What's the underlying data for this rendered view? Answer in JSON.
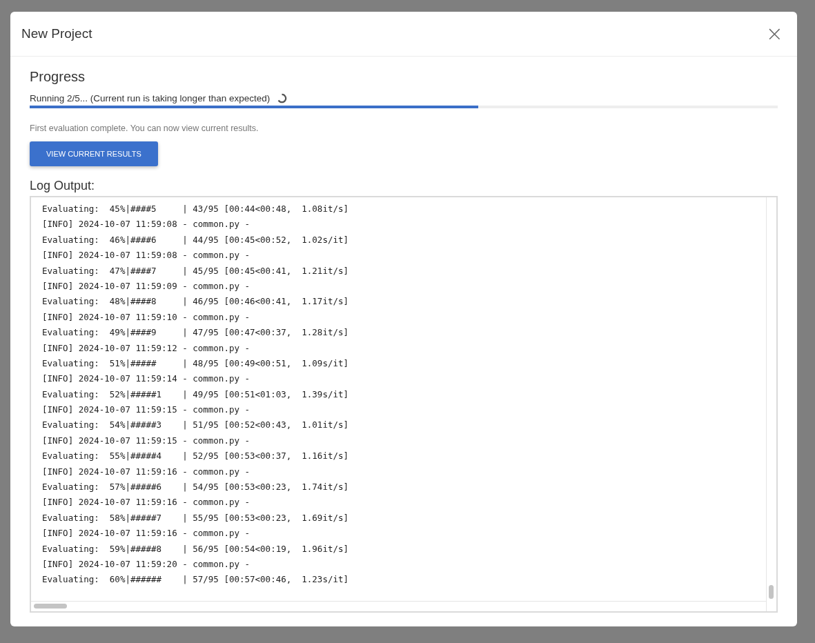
{
  "dialog": {
    "title": "New Project",
    "close_label": "×"
  },
  "progress": {
    "heading": "Progress",
    "status": "Running 2/5... (Current run is taking longer than expected)",
    "level": 0.6,
    "message": "First evaluation complete. You can now view current results.",
    "button": "VIEW CURRENT RESULTS"
  },
  "log": {
    "heading": "Log Output:",
    "lines": [
      "Evaluating:  45%|####5     | 43/95 [00:44<00:48,  1.08it/s]",
      "[INFO] 2024-10-07 11:59:08 - common.py -",
      "Evaluating:  46%|####6     | 44/95 [00:45<00:52,  1.02s/it]",
      "[INFO] 2024-10-07 11:59:08 - common.py -",
      "Evaluating:  47%|####7     | 45/95 [00:45<00:41,  1.21it/s]",
      "[INFO] 2024-10-07 11:59:09 - common.py -",
      "Evaluating:  48%|####8     | 46/95 [00:46<00:41,  1.17it/s]",
      "[INFO] 2024-10-07 11:59:10 - common.py -",
      "Evaluating:  49%|####9     | 47/95 [00:47<00:37,  1.28it/s]",
      "[INFO] 2024-10-07 11:59:12 - common.py -",
      "Evaluating:  51%|#####     | 48/95 [00:49<00:51,  1.09s/it]",
      "[INFO] 2024-10-07 11:59:14 - common.py -",
      "Evaluating:  52%|#####1    | 49/95 [00:51<01:03,  1.39s/it]",
      "[INFO] 2024-10-07 11:59:15 - common.py -",
      "Evaluating:  54%|#####3    | 51/95 [00:52<00:43,  1.01it/s]",
      "[INFO] 2024-10-07 11:59:15 - common.py -",
      "Evaluating:  55%|#####4    | 52/95 [00:53<00:37,  1.16it/s]",
      "[INFO] 2024-10-07 11:59:16 - common.py -",
      "Evaluating:  57%|#####6    | 54/95 [00:53<00:23,  1.74it/s]",
      "[INFO] 2024-10-07 11:59:16 - common.py -",
      "Evaluating:  58%|#####7    | 55/95 [00:53<00:23,  1.69it/s]",
      "[INFO] 2024-10-07 11:59:16 - common.py -",
      "Evaluating:  59%|#####8    | 56/95 [00:54<00:19,  1.96it/s]",
      "[INFO] 2024-10-07 11:59:20 - common.py -",
      "Evaluating:  60%|######    | 57/95 [00:57<00:46,  1.23s/it]"
    ]
  }
}
